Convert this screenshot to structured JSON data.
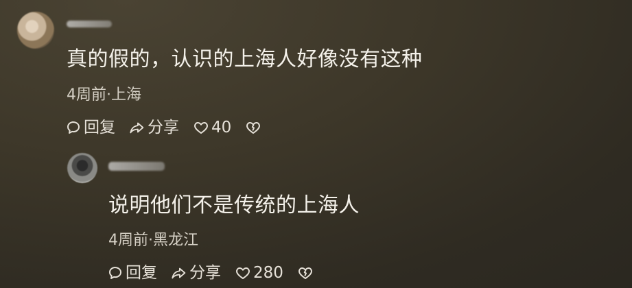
{
  "comments": {
    "main": {
      "text": "真的假的，认识的上海人好像没有这种",
      "meta": "4周前·上海",
      "reply_label": "回复",
      "share_label": "分享",
      "like_count": "40"
    },
    "reply": {
      "text": "说明他们不是传统的上海人",
      "meta": "4周前·黑龙江",
      "reply_label": "回复",
      "share_label": "分享",
      "like_count": "280"
    }
  },
  "icons": {
    "reply": "speech-bubble-icon",
    "share": "share-arrow-icon",
    "like": "heart-icon",
    "dislike": "broken-heart-icon"
  },
  "colors": {
    "background": "#3d3729",
    "text": "#f4f1ea",
    "meta": "#d5d0c5"
  }
}
